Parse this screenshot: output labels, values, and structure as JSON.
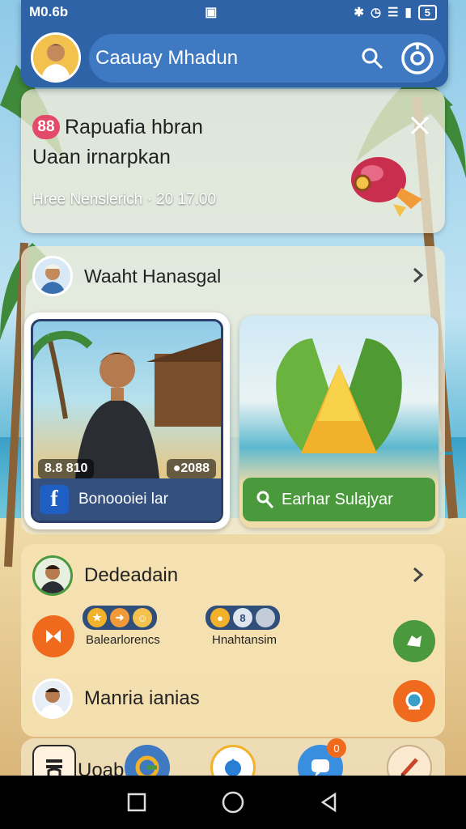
{
  "status": {
    "time": "M0.6b",
    "battery": "5"
  },
  "header": {
    "name": "Caauay Mhadun",
    "search_icon": "search-icon",
    "settings_icon": "target-icon"
  },
  "notification": {
    "badge": "88",
    "title": "Rapuafia hbran",
    "subtitle": "Uaan irnarpkan",
    "meta": "Hree Nenslerich · 20 17.00"
  },
  "card2": {
    "title": "Waaht Hanasgal",
    "tile_left": {
      "stat_left": "8.8 810",
      "stat_right": "●2088",
      "label": "Bonoooiei lar"
    },
    "tile_right": {
      "button_label": "Earhar Sulajyar"
    }
  },
  "card3": {
    "row1_title": "Dedeadain",
    "group1_label": "Balearlorencs",
    "group2_label": "Hnahtansim",
    "group2_pill_text": "8",
    "row3_title": "Manria ianias"
  },
  "tabbar": {
    "label": "Uoab",
    "badge": "0"
  },
  "colors": {
    "header": "#2f63a8",
    "accent_green": "#4a9a3d",
    "badge_pink": "#e34a6a",
    "orange": "#f06a1e"
  }
}
